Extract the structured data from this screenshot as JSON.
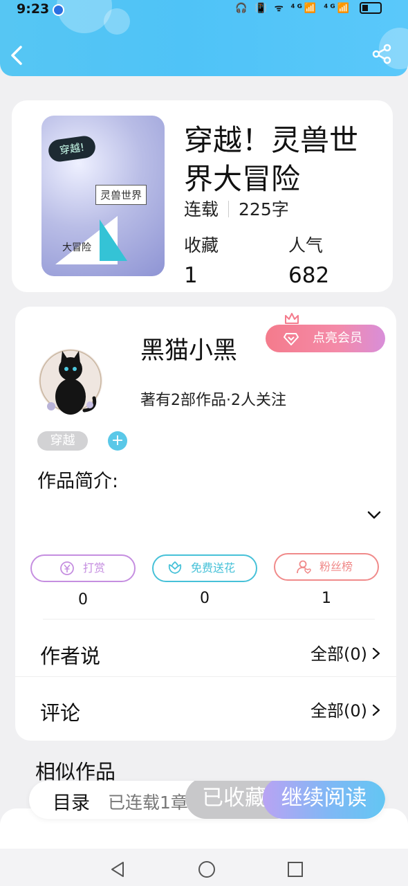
{
  "status_bar": {
    "time": "9:23",
    "indicators": "🎧 📳 ᯤ ⁴ᴳ📶 ⁴ᴳ📶"
  },
  "colors": {
    "header": "#4fc3f7",
    "accent_teal": "#5ac8e8",
    "vip_pink": "#f47b8c",
    "reward_purple": "#c58ee0",
    "flower_teal": "#46c1d8",
    "fans_red": "#f08a8a"
  },
  "book": {
    "cover_tags": [
      "穿越!",
      "灵兽世界",
      "大冒险"
    ],
    "title": "穿越！灵兽世界大冒险",
    "status": "连载",
    "word_count": "225字",
    "favorites_label": "收藏",
    "favorites_value": "1",
    "popularity_label": "人气",
    "popularity_value": "682"
  },
  "author": {
    "name": "黑猫小黑",
    "stats": "著有2部作品·2人关注",
    "vip_label": "点亮会员",
    "genre_tag": "穿越",
    "add_tag": "+",
    "intro_label": "作品简介:"
  },
  "actions": [
    {
      "label": "打赏",
      "icon": "yen-coin-icon",
      "count": "0"
    },
    {
      "label": "免费送花",
      "icon": "flower-icon",
      "count": "0"
    },
    {
      "label": "粉丝榜",
      "icon": "fan-user-icon",
      "count": "1"
    }
  ],
  "author_says": {
    "label": "作者说",
    "link": "全部(0)"
  },
  "comments": {
    "label": "评论",
    "link": "全部(0)"
  },
  "similar_title": "相似作品",
  "bottom": {
    "toc_label": "目录",
    "chapters": "已连载1章",
    "favorited_label": "已收藏",
    "continue_label": "继续阅读"
  }
}
